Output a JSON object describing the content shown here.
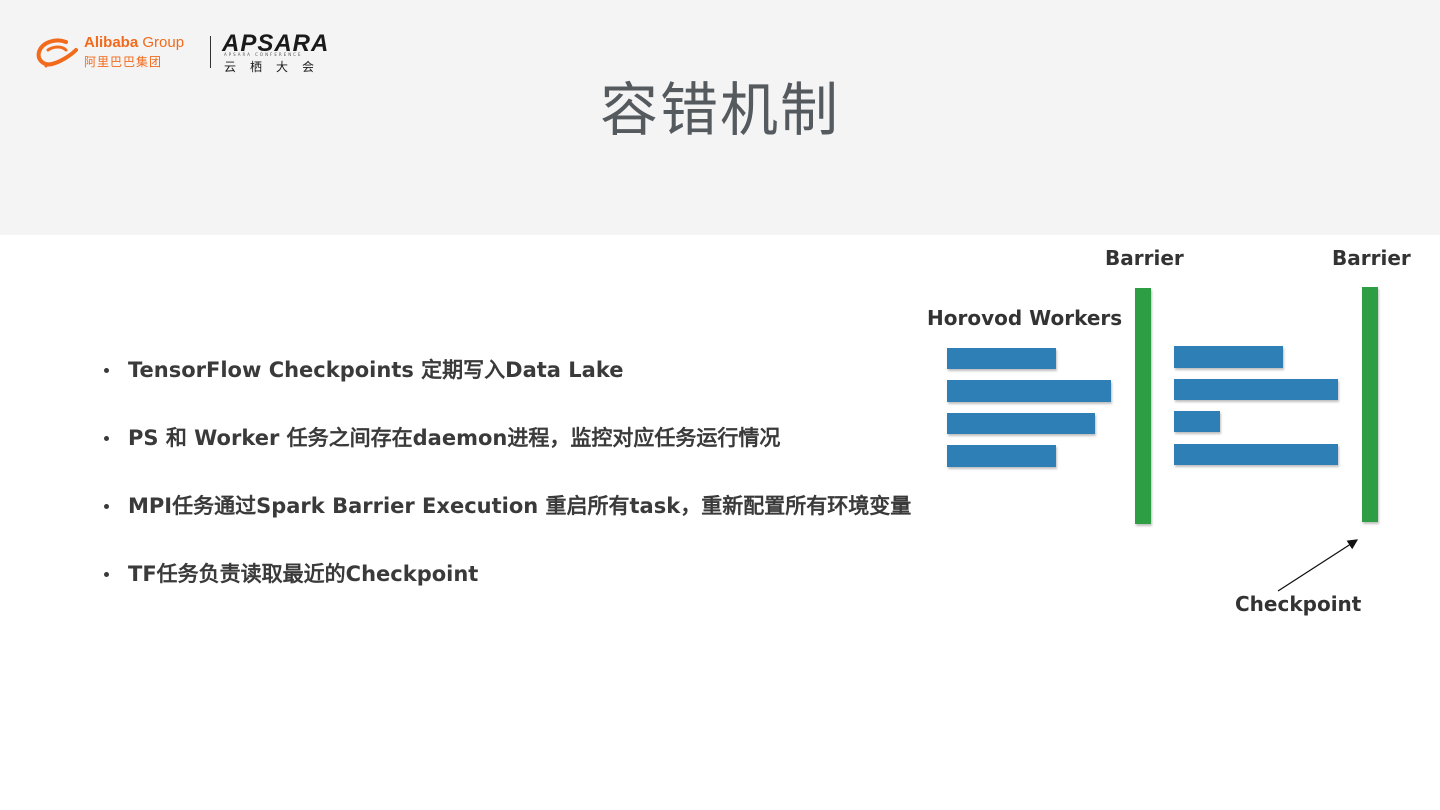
{
  "logo": {
    "alibaba": "Alibaba",
    "alibaba_group": "Group",
    "alibaba_cn": "阿里巴巴集团",
    "apsara": "APSARA",
    "apsara_sub": "APSARA CONFERENCE",
    "apsara_cn": "云栖大会"
  },
  "title": "容错机制",
  "bullets": [
    "TensorFlow Checkpoints 定期写入Data Lake",
    "PS 和 Worker 任务之间存在daemon进程，监控对应任务运行情况",
    "MPI任务通过Spark Barrier Execution 重启所有task，重新配置所有环境变量",
    "TF任务负责读取最近的Checkpoint"
  ],
  "diagram": {
    "barrier_label_1": "Barrier",
    "barrier_label_2": "Barrier",
    "workers_label": "Horovod Workers",
    "checkpoint_label": "Checkpoint",
    "worker_color": "#2f7fb5",
    "barrier_color": "#2e9e44"
  }
}
